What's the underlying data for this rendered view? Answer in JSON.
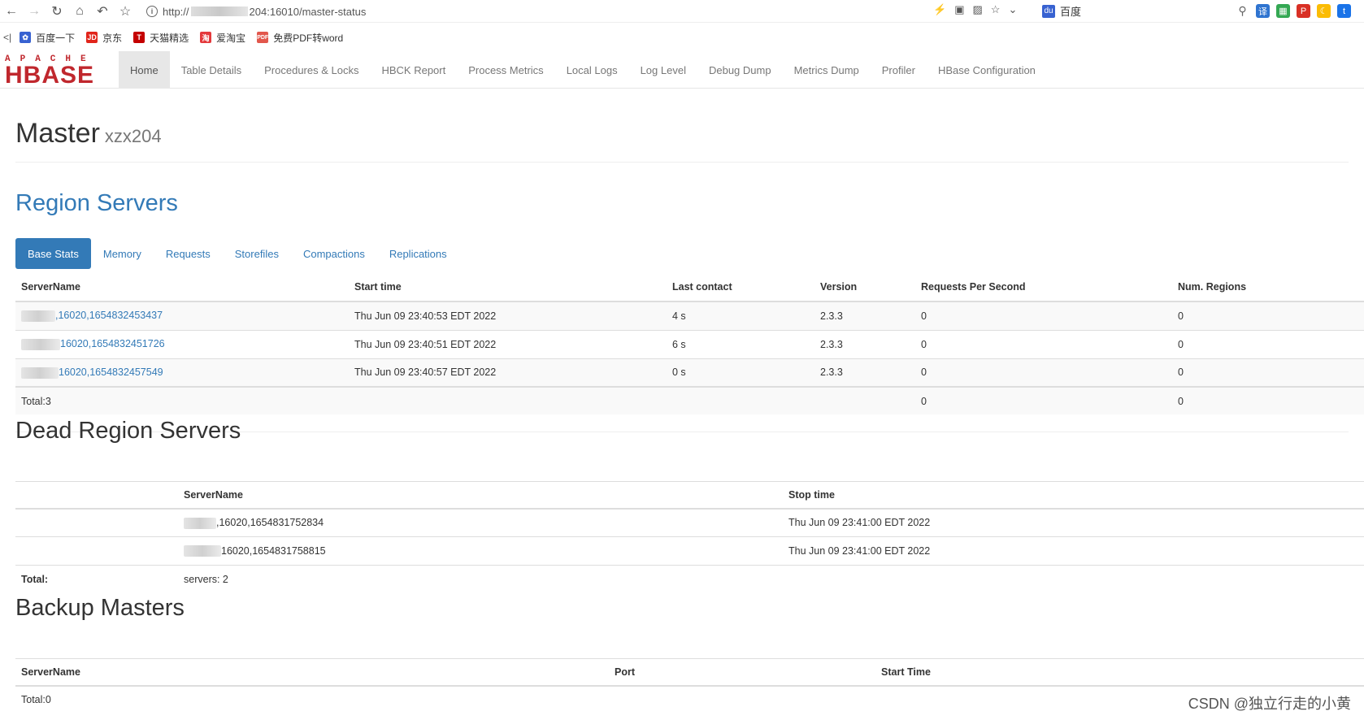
{
  "browser": {
    "url_prefix": "http://",
    "url_suffix": "204:16010/master-status",
    "search_engine": "百度",
    "bookmarks": [
      {
        "label": "百度一下",
        "icon": "paw-icon",
        "color": "#3862d1"
      },
      {
        "label": "京东",
        "icon": "jd-icon",
        "color": "#e1251b"
      },
      {
        "label": "天猫精选",
        "icon": "tmall-icon",
        "color": "#c40000"
      },
      {
        "label": "爱淘宝",
        "icon": "taobao-icon",
        "color": "#e4393c"
      },
      {
        "label": "免费PDF转word",
        "icon": "pdf-icon",
        "color": "#e2574c"
      }
    ]
  },
  "navbar": {
    "brand_top": "APACHE",
    "brand_main": "HBASE",
    "items": [
      "Home",
      "Table Details",
      "Procedures & Locks",
      "HBCK Report",
      "Process Metrics",
      "Local Logs",
      "Log Level",
      "Debug Dump",
      "Metrics Dump",
      "Profiler",
      "HBase Configuration"
    ],
    "active": "Home"
  },
  "header": {
    "title": "Master",
    "host": "xzx204"
  },
  "region_servers": {
    "title": "Region Servers",
    "tabs": [
      "Base Stats",
      "Memory",
      "Requests",
      "Storefiles",
      "Compactions",
      "Replications"
    ],
    "columns": [
      "ServerName",
      "Start time",
      "Last contact",
      "Version",
      "Requests Per Second",
      "Num. Regions"
    ],
    "rows": [
      {
        "server": ",16020,1654832453437",
        "start": "Thu Jun 09 23:40:53 EDT 2022",
        "last_contact": "4 s",
        "version": "2.3.3",
        "rps": "0",
        "regions": "0"
      },
      {
        "server": "16020,1654832451726",
        "start": "Thu Jun 09 23:40:51 EDT 2022",
        "last_contact": "6 s",
        "version": "2.3.3",
        "rps": "0",
        "regions": "0"
      },
      {
        "server": "16020,1654832457549",
        "start": "Thu Jun 09 23:40:57 EDT 2022",
        "last_contact": "0 s",
        "version": "2.3.3",
        "rps": "0",
        "regions": "0"
      }
    ],
    "total_label": "Total:3",
    "total_rps": "0",
    "total_regions": "0"
  },
  "dead_region_servers": {
    "title": "Dead Region Servers",
    "columns": [
      "ServerName",
      "Stop time"
    ],
    "rows": [
      {
        "server": ",16020,1654831752834",
        "stop": "Thu Jun 09 23:41:00 EDT 2022"
      },
      {
        "server": "16020,1654831758815",
        "stop": "Thu Jun 09 23:41:00 EDT 2022"
      }
    ],
    "total_label": "Total:",
    "total_value": "servers: 2"
  },
  "backup_masters": {
    "title": "Backup Masters",
    "columns": [
      "ServerName",
      "Port",
      "Start Time"
    ],
    "total_label": "Total:0"
  },
  "watermark": "CSDN @独立行走的小黄"
}
